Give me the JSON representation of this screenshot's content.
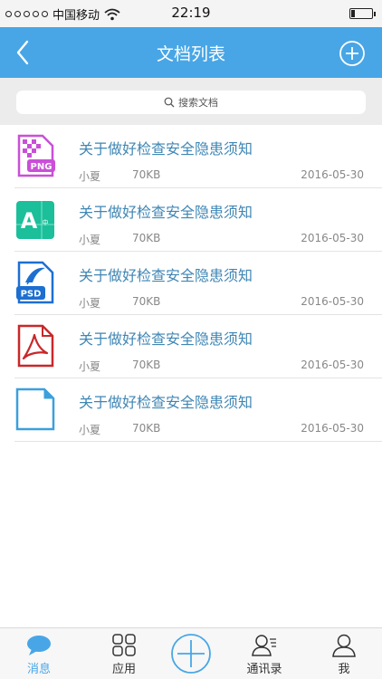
{
  "status_bar": {
    "carrier": "中国移动",
    "time": "22:19"
  },
  "nav": {
    "title": "文档列表",
    "back_icon": "chevron-left-icon",
    "add_icon": "plus-circle-icon"
  },
  "search": {
    "placeholder": "搜索文档"
  },
  "documents": [
    {
      "icon": "png-file-icon",
      "badge": "PNG",
      "name": "关于做好检查安全隐患须知",
      "author": "小夏",
      "size": "70KB",
      "date": "2016-05-30"
    },
    {
      "icon": "font-file-icon",
      "badge": "A",
      "name": "关于做好检查安全隐患须知",
      "author": "小夏",
      "size": "70KB",
      "date": "2016-05-30"
    },
    {
      "icon": "psd-file-icon",
      "badge": "PSD",
      "name": "关于做好检查安全隐患须知",
      "author": "小夏",
      "size": "70KB",
      "date": "2016-05-30"
    },
    {
      "icon": "pdf-file-icon",
      "badge": "",
      "name": "关于做好检查安全隐患须知",
      "author": "小夏",
      "size": "70KB",
      "date": "2016-05-30"
    },
    {
      "icon": "document-file-icon",
      "badge": "",
      "name": "关于做好检查安全隐患须知",
      "author": "小夏",
      "size": "70KB",
      "date": "2016-05-30"
    }
  ],
  "tabs": [
    {
      "label": "消息",
      "icon": "chat-bubble-icon"
    },
    {
      "label": "应用",
      "icon": "apps-grid-icon"
    },
    {
      "label": "",
      "icon": "plus-circle-icon"
    },
    {
      "label": "通讯录",
      "icon": "contacts-icon"
    },
    {
      "label": "我",
      "icon": "user-icon"
    }
  ],
  "colors": {
    "accent": "#48a6e6",
    "link_text": "#3f86b4"
  }
}
